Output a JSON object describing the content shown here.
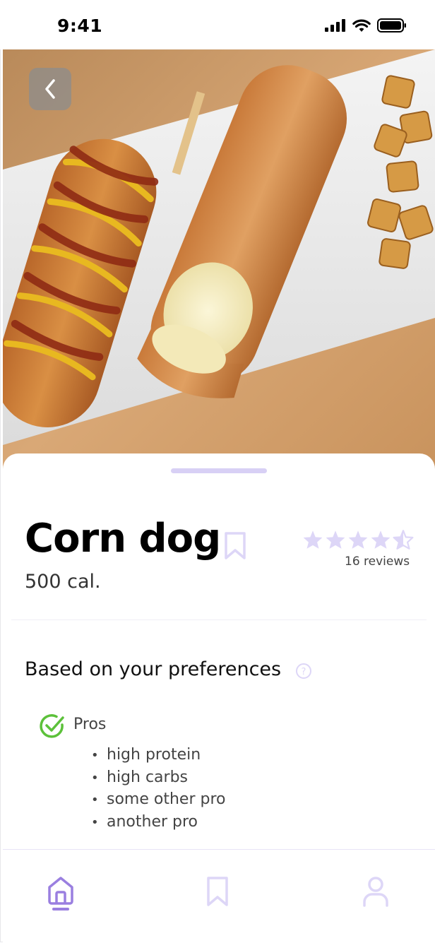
{
  "status_bar": {
    "time": "9:41"
  },
  "food": {
    "name": "Corn dog",
    "calories": "500 cal.",
    "rating": 4.5,
    "reviews": "16 reviews"
  },
  "preferences": {
    "title": "Based on your preferences",
    "pros_label": "Pros",
    "pros": [
      "high protein",
      "high carbs",
      "some other pro",
      "another pro"
    ]
  },
  "colors": {
    "accent": "#9a7fe0",
    "accent_light": "#ddd6f7",
    "check_green": "#5cc13a"
  },
  "nav": {
    "items": [
      {
        "icon": "home-icon",
        "active": true
      },
      {
        "icon": "bookmark-icon",
        "active": false
      },
      {
        "icon": "profile-icon",
        "active": false
      }
    ]
  }
}
